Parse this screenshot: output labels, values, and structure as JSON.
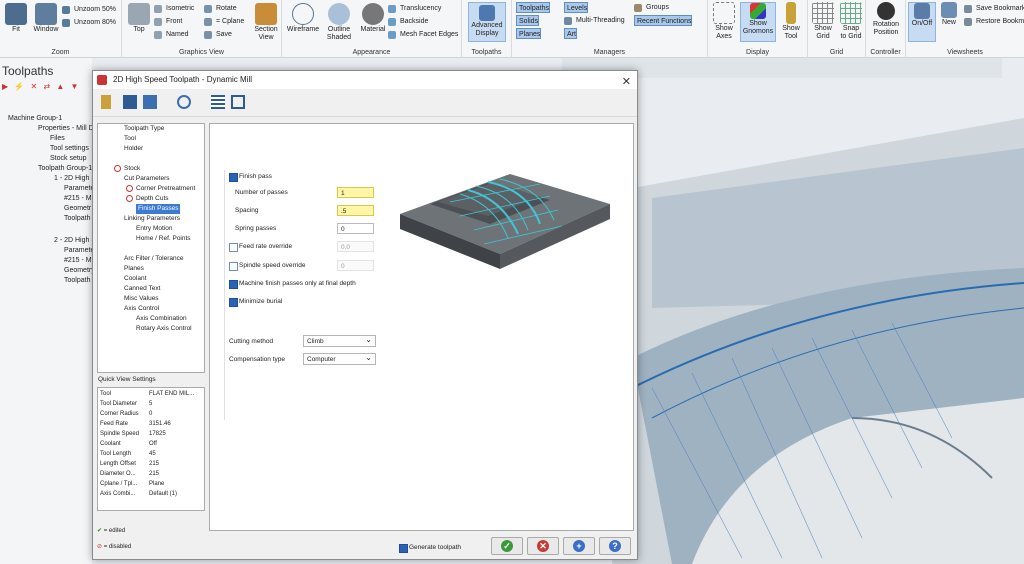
{
  "ribbon": {
    "zoom": {
      "fit": "Fit",
      "window": "Window",
      "unzoom50": "Unzoom 50%",
      "unzoom80": "Unzoom 80%",
      "label": "Zoom"
    },
    "graphics": {
      "top": "Top",
      "isometric": "Isometric",
      "front": "Front",
      "named": "Named",
      "rotate": "Rotate",
      "cplane": "= Cplane",
      "save": "Save",
      "section": "Section\nView",
      "label": "Graphics View"
    },
    "appearance": {
      "wireframe": "Wireframe",
      "outline": "Outline\nShaded",
      "material": "Material",
      "translucency": "Translucency",
      "backside": "Backside",
      "mesh": "Mesh Facet Edges",
      "label": "Appearance"
    },
    "toolpaths": {
      "advanced": "Advanced\nDisplay",
      "label": "Toolpaths"
    },
    "managers": {
      "toolpaths": "Toolpaths",
      "solids": "Solids",
      "planes": "Planes",
      "levels": "Levels",
      "multithreading": "Multi-Threading",
      "art": "Art",
      "groups": "Groups",
      "recent": "Recent Functions",
      "label": "Managers"
    },
    "display": {
      "axes": "Show\nAxes",
      "gnomons": "Show\nGnomons",
      "tool": "Show\nTool",
      "label": "Display"
    },
    "grid": {
      "show": "Show\nGrid",
      "snap": "Snap\nto Grid",
      "label": "Grid"
    },
    "controller": {
      "rotation": "Rotation\nPosition",
      "label": "Controller"
    },
    "viewsheets": {
      "onoff": "On/Off",
      "new": "New",
      "save": "Save Bookmark",
      "restore": "Restore Bookma",
      "label": "Viewsheets"
    }
  },
  "left_panel": {
    "title": "Toolpaths",
    "tree": [
      "Machine Group-1",
      "Properties - Mill D",
      "Files",
      "Tool settings",
      "Stock setup",
      "Toolpath Group-1",
      "1 - 2D High Sp",
      "Paramete",
      "#215 - M",
      "Geometr",
      "Toolpath",
      "2 - 2D High Sp",
      "Paramete",
      "#215 - M",
      "Geometry",
      "Toolpath"
    ]
  },
  "dialog": {
    "title": "2D High Speed Toolpath - Dynamic Mill",
    "tree": [
      "Toolpath Type",
      "Tool",
      "Holder",
      "Stock",
      "Cut Parameters",
      "Corner Pretreatment",
      "Depth Cuts",
      "Finish Passes",
      "Linking Parameters",
      "Entry Motion",
      "Home / Ref. Points",
      "Arc Filter / Tolerance",
      "Planes",
      "Coolant",
      "Canned Text",
      "Misc Values",
      "Axis Control",
      "Axis Combination",
      "Rotary Axis Control"
    ],
    "quick_view": {
      "title": "Quick View Settings",
      "rows": [
        {
          "k": "Tool",
          "v": "FLAT END MIL..."
        },
        {
          "k": "Tool Diameter",
          "v": "5"
        },
        {
          "k": "Corner Radius",
          "v": "0"
        },
        {
          "k": "Feed Rate",
          "v": "3151.46"
        },
        {
          "k": "Spindle Speed",
          "v": "17825"
        },
        {
          "k": "Coolant",
          "v": "Off"
        },
        {
          "k": "Tool Length",
          "v": "45"
        },
        {
          "k": "Length Offset",
          "v": "215"
        },
        {
          "k": "Diameter O...",
          "v": "215"
        },
        {
          "k": "Cplane / Tpl...",
          "v": "Plane"
        },
        {
          "k": "Axis Combi...",
          "v": "Default (1)"
        }
      ]
    },
    "legend": {
      "edited": "= edited",
      "disabled": "= disabled"
    },
    "finish": {
      "finish_pass": "Finish pass",
      "num_passes_label": "Number of passes",
      "num_passes": "1",
      "spacing_label": "Spacing",
      "spacing": ".5",
      "spring_label": "Spring passes",
      "spring": "0",
      "feed_override": "Feed rate override",
      "feed_value": "0.0",
      "spindle_override": "Spindle speed override",
      "spindle_value": "0",
      "machine_final": "Machine finish passes only at final depth",
      "minimize_burial": "Minimize burial",
      "cutting_method_label": "Cutting method",
      "cutting_method": "Climb",
      "comp_type_label": "Compensation type",
      "comp_type": "Computer"
    },
    "generate": "Generate toolpath",
    "buttons": {
      "ok": "✓",
      "cancel": "✕",
      "add": "+",
      "help": "?"
    }
  }
}
